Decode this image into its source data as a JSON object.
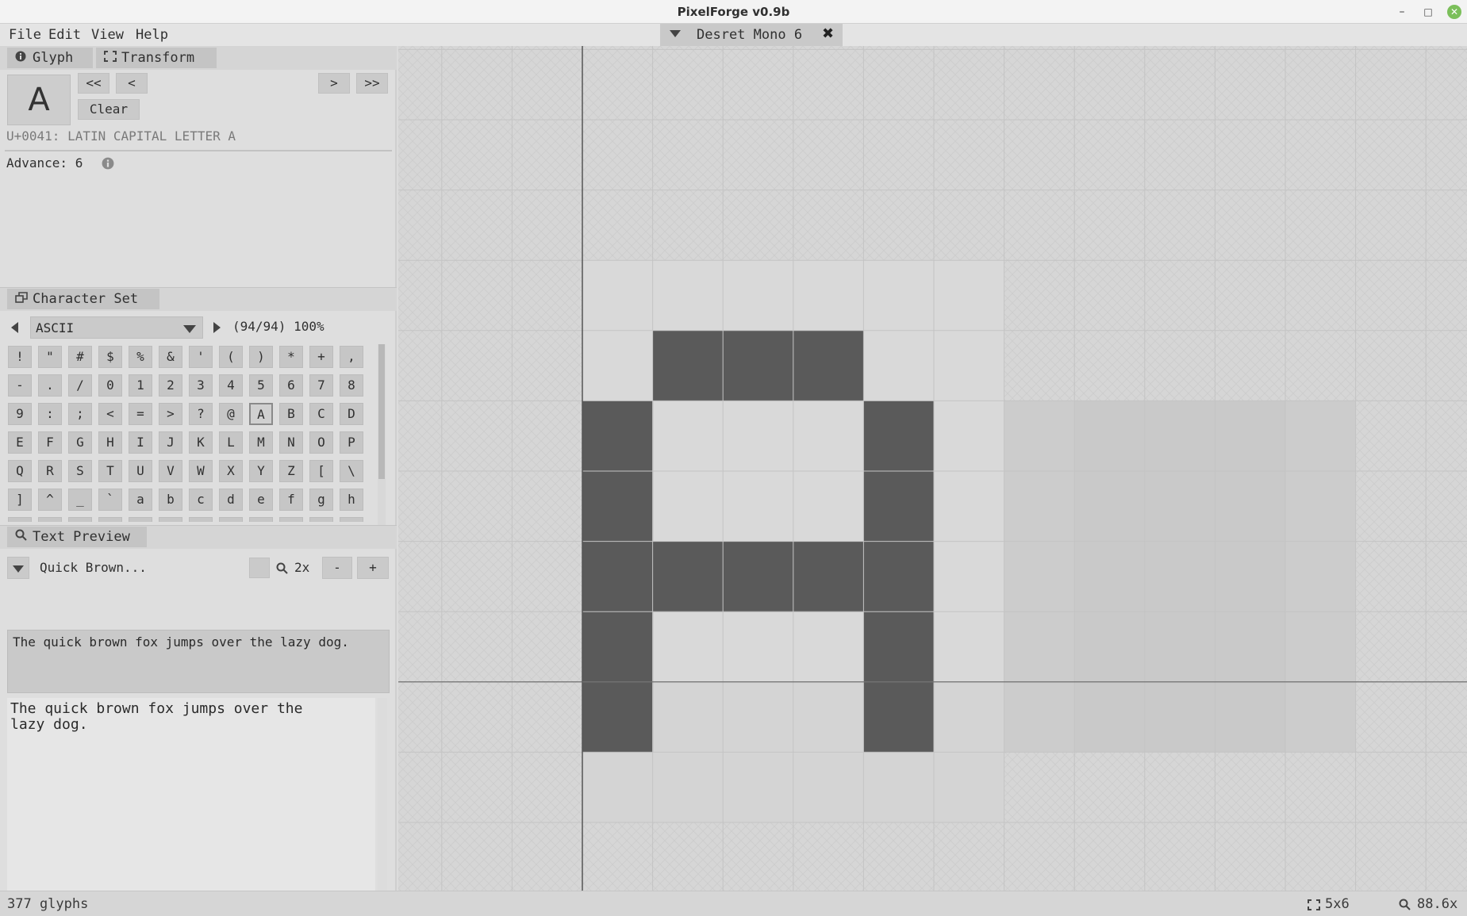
{
  "window": {
    "title": "PixelForge v0.9b",
    "minimize_glyph": "–",
    "maximize_glyph": "□",
    "close_glyph": "✕"
  },
  "menu": {
    "items": [
      "File",
      "Edit",
      "View",
      "Help"
    ]
  },
  "document_tab": {
    "label": "Desret Mono 6",
    "close_glyph": "✖"
  },
  "glyph_panel": {
    "tabs": [
      {
        "label": "Glyph",
        "icon": "info-icon"
      },
      {
        "label": "Transform",
        "icon": "bracket-frame-icon"
      }
    ],
    "preview_char": "A",
    "nav": {
      "first": "<<",
      "prev": "<",
      "next": ">",
      "last": ">>"
    },
    "clear_label": "Clear",
    "unicode_name": "U+0041: LATIN CAPITAL LETTER A",
    "advance_label": "Advance: 6",
    "advance_info_icon": "info-icon"
  },
  "charset_panel": {
    "tab_label": "Character Set",
    "tab_icon": "windows-icon",
    "selected_set": "ASCII",
    "coverage": "(94/94) 100%",
    "characters": [
      "!",
      "\"",
      "#",
      "$",
      "%",
      "&",
      "'",
      "(",
      ")",
      "*",
      "+",
      ",",
      "-",
      ".",
      "/",
      "0",
      "1",
      "2",
      "3",
      "4",
      "5",
      "6",
      "7",
      "8",
      "9",
      ":",
      ";",
      "<",
      "=",
      ">",
      "?",
      "@",
      "A",
      "B",
      "C",
      "D",
      "E",
      "F",
      "G",
      "H",
      "I",
      "J",
      "K",
      "L",
      "M",
      "N",
      "O",
      "P",
      "Q",
      "R",
      "S",
      "T",
      "U",
      "V",
      "W",
      "X",
      "Y",
      "Z",
      "[",
      "\\",
      "]",
      "^",
      "_",
      "`",
      "a",
      "b",
      "c",
      "d",
      "e",
      "f",
      "g",
      "h"
    ],
    "selected_char": "A"
  },
  "text_preview_panel": {
    "tab_label": "Text Preview",
    "tab_icon": "magnifier-icon",
    "preset": "Quick Brown...",
    "zoom_label": "2x",
    "zoom_minus": "-",
    "zoom_plus": "+",
    "input_text": "The quick brown fox jumps over the lazy dog.",
    "output_text": "The quick brown fox jumps over the\nlazy dog."
  },
  "editor_canvas": {
    "glyph": "A",
    "grid_size": "5x6",
    "pixel_color": "#5a5a5a",
    "bitmap": [
      [
        0,
        1,
        1,
        1,
        0
      ],
      [
        1,
        0,
        0,
        0,
        1
      ],
      [
        1,
        0,
        0,
        0,
        1
      ],
      [
        1,
        1,
        1,
        1,
        1
      ],
      [
        1,
        0,
        0,
        0,
        1
      ],
      [
        1,
        0,
        0,
        0,
        1
      ]
    ]
  },
  "status": {
    "glyph_count": "377 glyphs",
    "grid_size": "5x6",
    "zoom": "88.6x",
    "grid_icon": "bracket-frame-icon",
    "zoom_icon": "magnifier-icon"
  }
}
